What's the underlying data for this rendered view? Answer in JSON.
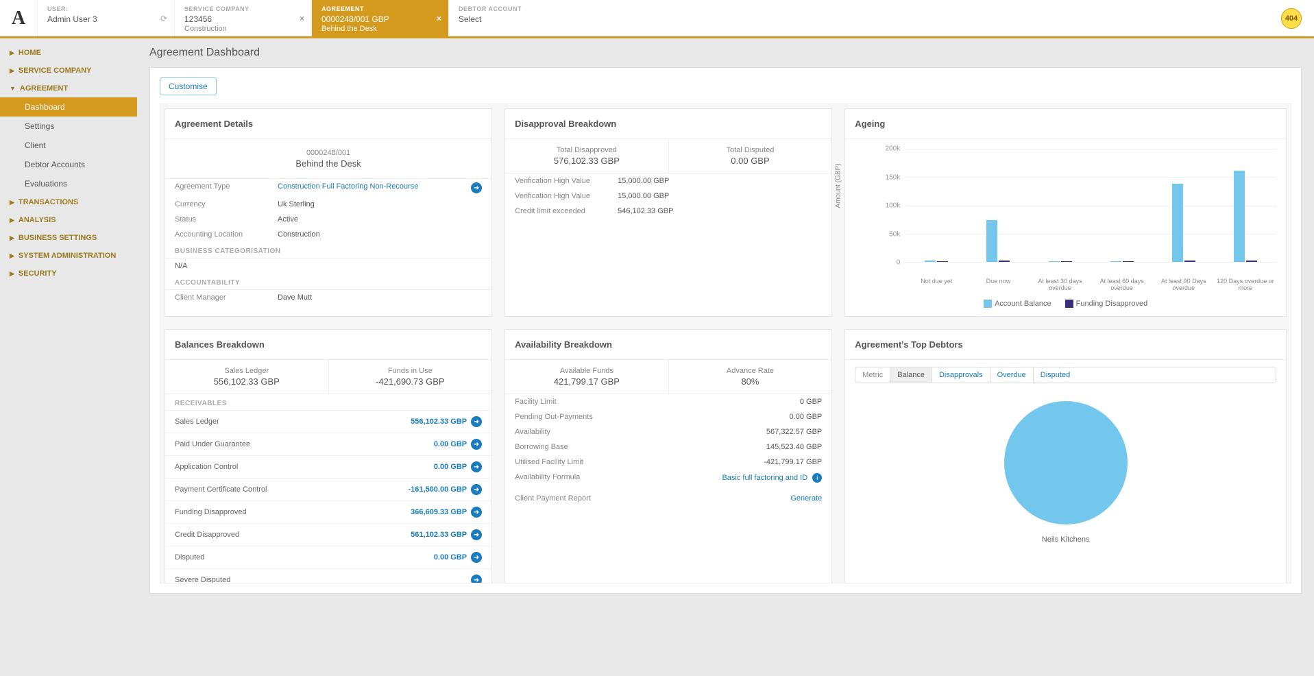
{
  "header": {
    "user_label": "USER:",
    "user_value": "Admin User 3",
    "service_label": "SERVICE COMPANY",
    "service_value": "123456",
    "service_sub": "Construction",
    "agreement_label": "AGREEMENT",
    "agreement_value": "0000248/001 GBP",
    "agreement_sub": "Behind the Desk",
    "debtor_label": "DEBTOR ACCOUNT",
    "debtor_value": "Select",
    "badge": "404"
  },
  "sidebar": {
    "items": [
      {
        "label": "HOME",
        "expanded": false
      },
      {
        "label": "SERVICE COMPANY",
        "expanded": false
      },
      {
        "label": "AGREEMENT",
        "expanded": true,
        "children": [
          {
            "label": "Dashboard",
            "active": true
          },
          {
            "label": "Settings"
          },
          {
            "label": "Client"
          },
          {
            "label": "Debtor Accounts"
          },
          {
            "label": "Evaluations"
          }
        ]
      },
      {
        "label": "TRANSACTIONS",
        "expanded": false
      },
      {
        "label": "ANALYSIS",
        "expanded": false
      },
      {
        "label": "BUSINESS SETTINGS",
        "expanded": false
      },
      {
        "label": "SYSTEM ADMINISTRATION",
        "expanded": false
      },
      {
        "label": "SECURITY",
        "expanded": false
      }
    ]
  },
  "page": {
    "title": "Agreement Dashboard",
    "customise": "Customise"
  },
  "agreement_details": {
    "title": "Agreement Details",
    "num": "0000248/001",
    "name": "Behind the Desk",
    "rows": [
      {
        "k": "Agreement Type",
        "v": "Construction Full Factoring Non-Recourse",
        "link": true,
        "arrow": true
      },
      {
        "k": "Currency",
        "v": "Uk Sterling"
      },
      {
        "k": "Status",
        "v": "Active"
      },
      {
        "k": "Accounting Location",
        "v": "Construction"
      }
    ],
    "bizcat_label": "BUSINESS CATEGORISATION",
    "bizcat_value": "N/A",
    "acct_label": "ACCOUNTABILITY",
    "client_manager_k": "Client Manager",
    "client_manager_v": "Dave Mutt"
  },
  "disapproval": {
    "title": "Disapproval Breakdown",
    "total_disapproved_lbl": "Total Disapproved",
    "total_disapproved_val": "576,102.33 GBP",
    "total_disputed_lbl": "Total Disputed",
    "total_disputed_val": "0.00 GBP",
    "rows": [
      {
        "k": "Verification High Value",
        "v": "15,000.00 GBP"
      },
      {
        "k": "Verification High Value",
        "v": "15,000.00 GBP"
      },
      {
        "k": "Credit limit exceeded",
        "v": "546,102.33 GBP"
      }
    ]
  },
  "ageing": {
    "title": "Ageing",
    "ylabel": "Amount (GBP)",
    "legend1": "Account Balance",
    "legend2": "Funding Disapproved"
  },
  "chart_data": {
    "type": "bar",
    "title": "Ageing",
    "ylabel": "Amount (GBP)",
    "ylim": [
      0,
      200000
    ],
    "yticks": [
      0,
      50000,
      100000,
      150000,
      200000
    ],
    "ytick_labels": [
      "0",
      "50k",
      "100k",
      "150k",
      "200k"
    ],
    "categories": [
      "Not due yet",
      "Due now",
      "At least 30 days overdue",
      "At least 60 days overdue",
      "At least 90 Days overdue",
      "120 Days overdue or more"
    ],
    "series": [
      {
        "name": "Account Balance",
        "values": [
          2000,
          73000,
          1000,
          1000,
          137000,
          160000
        ],
        "color": "#74c7ec"
      },
      {
        "name": "Funding Disapproved",
        "values": [
          0,
          2000,
          0,
          500,
          2000,
          3000
        ],
        "color": "#3a2d7a"
      }
    ]
  },
  "balances": {
    "title": "Balances Breakdown",
    "sales_ledger_lbl": "Sales Ledger",
    "sales_ledger_val": "556,102.33 GBP",
    "funds_in_use_lbl": "Funds in Use",
    "funds_in_use_val": "-421,690.73 GBP",
    "receivables_label": "RECEIVABLES",
    "rows": [
      {
        "k": "Sales Ledger",
        "v": "556,102.33 GBP"
      },
      {
        "k": "Paid Under Guarantee",
        "v": "0.00 GBP"
      },
      {
        "k": "Application Control",
        "v": "0.00 GBP"
      },
      {
        "k": "Payment Certificate Control",
        "v": "-161,500.00 GBP"
      },
      {
        "k": "Funding Disapproved",
        "v": "366,609.33 GBP"
      },
      {
        "k": "Credit Disapproved",
        "v": "561,102.33 GBP"
      },
      {
        "k": "Disputed",
        "v": "0.00 GBP"
      },
      {
        "k": "Severe Disputed",
        "v": ""
      }
    ]
  },
  "availability": {
    "title": "Availability Breakdown",
    "avail_funds_lbl": "Available Funds",
    "avail_funds_val": "421,799.17 GBP",
    "advance_rate_lbl": "Advance Rate",
    "advance_rate_val": "80%",
    "rows": [
      {
        "k": "Facility Limit",
        "v": "0 GBP"
      },
      {
        "k": "Pending Out-Payments",
        "v": "0.00 GBP"
      },
      {
        "k": "Availability",
        "v": "567,322.57 GBP"
      },
      {
        "k": "Borrowing Base",
        "v": "145,523.40 GBP"
      },
      {
        "k": "Utilised Facility Limit",
        "v": "-421,799.17 GBP"
      }
    ],
    "formula_k": "Availability Formula",
    "formula_v": "Basic full factoring and ID",
    "report_k": "Client Payment Report",
    "report_v": "Generate"
  },
  "top_debtors": {
    "title": "Agreement's Top Debtors",
    "tabs": [
      "Metric",
      "Balance",
      "Disapprovals",
      "Overdue",
      "Disputed"
    ],
    "legend": "Neils Kitchens"
  }
}
